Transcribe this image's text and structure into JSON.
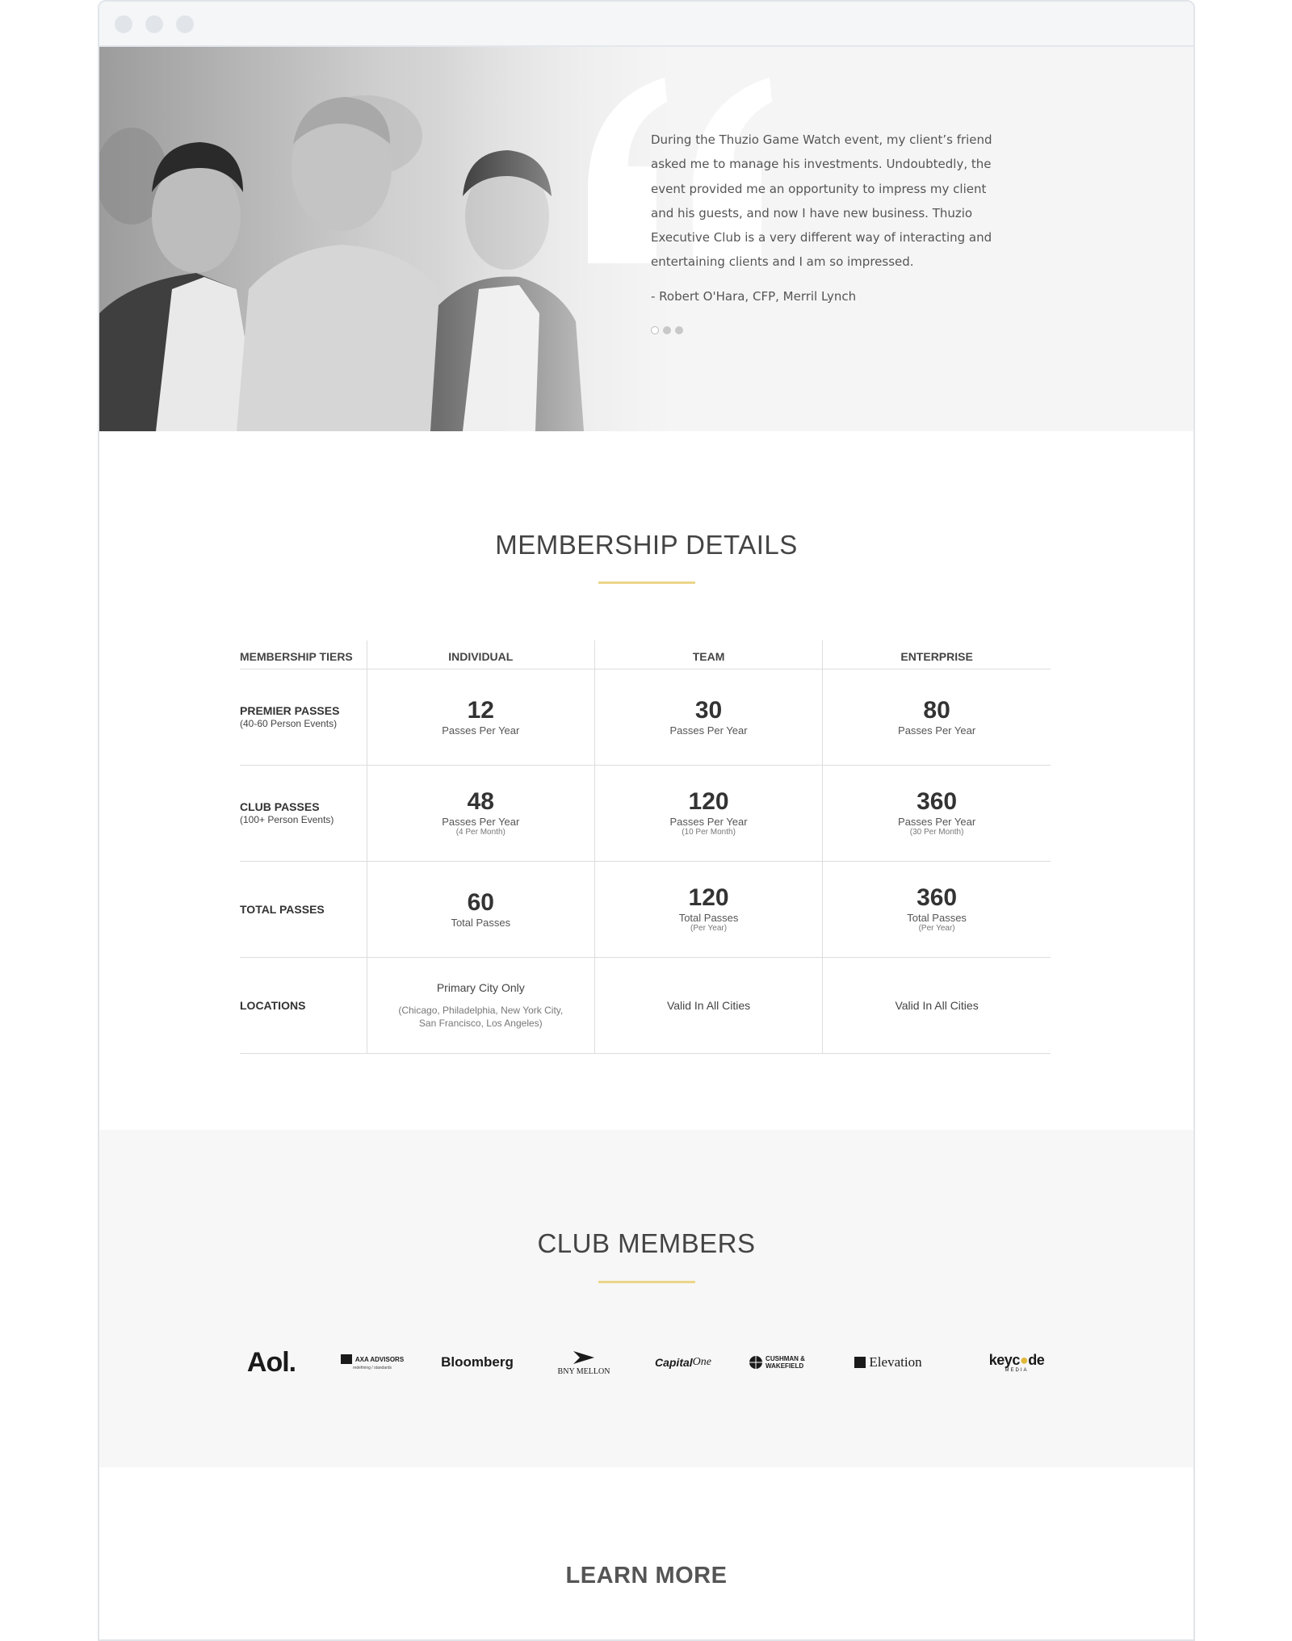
{
  "testimonial": {
    "text": "During the Thuzio Game Watch event, my client’s friend asked me to manage his investments. Undoubtedly, the event provided me an opportunity to impress my client and his guests, and now I have new business. Thuzio Executive Club is a very different way of interacting and entertaining clients and I am so impressed.",
    "author": "- Robert O'Hara, CFP, Merril Lynch"
  },
  "membership": {
    "title": "MEMBERSHIP DETAILS",
    "headers": [
      "MEMBERSHIP TIERS",
      "INDIVIDUAL",
      "TEAM",
      "ENTERPRISE"
    ],
    "rows": {
      "premier": {
        "label": "PREMIER PASSES",
        "sub": "(40-60 Person Events)",
        "cells": [
          {
            "value": "12",
            "unit": "Passes Per Year"
          },
          {
            "value": "30",
            "unit": "Passes Per Year"
          },
          {
            "value": "80",
            "unit": "Passes Per Year"
          }
        ]
      },
      "club": {
        "label": "CLUB PASSES",
        "sub": "(100+ Person Events)",
        "cells": [
          {
            "value": "48",
            "unit": "Passes Per Year",
            "note": "(4 Per Month)"
          },
          {
            "value": "120",
            "unit": "Passes Per Year",
            "note": "(10 Per Month)"
          },
          {
            "value": "360",
            "unit": "Passes Per Year",
            "note": "(30 Per Month)"
          }
        ]
      },
      "total": {
        "label": "TOTAL PASSES",
        "cells": [
          {
            "value": "60",
            "unit": "Total Passes"
          },
          {
            "value": "120",
            "unit": "Total Passes",
            "note": "(Per Year)"
          },
          {
            "value": "360",
            "unit": "Total Passes",
            "note": "(Per Year)"
          }
        ]
      },
      "locations": {
        "label": "LOCATIONS",
        "individual_main": "Primary City Only",
        "individual_sub_1": "(Chicago, Philadelphia, New York City,",
        "individual_sub_2": "San Francisco, Los Angeles)",
        "team": "Valid In All Cities",
        "enterprise": "Valid In All Cities"
      }
    }
  },
  "members": {
    "title": "CLUB MEMBERS",
    "logos": {
      "aol": "Aol.",
      "axa": "AXA ADVISORS",
      "axa_tagline": "redefining / standards",
      "bloomberg": "Bloomberg",
      "bny": "BNY MELLON",
      "capital_one_a": "Capital",
      "capital_one_b": "One",
      "cushman_1": "CUSHMAN &",
      "cushman_2": "WAKEFIELD",
      "elevation": "Elevation",
      "keycode_a": "keyc",
      "keycode_b": "de",
      "keycode_sub": "MEDIA"
    }
  },
  "footer": {
    "learn_more": "LEARN MORE"
  },
  "colors": {
    "accent_gold": "#ecd58a",
    "text_dark": "#333333",
    "hero_bg": "#f5f5f5",
    "members_bg": "#f7f7f7"
  }
}
